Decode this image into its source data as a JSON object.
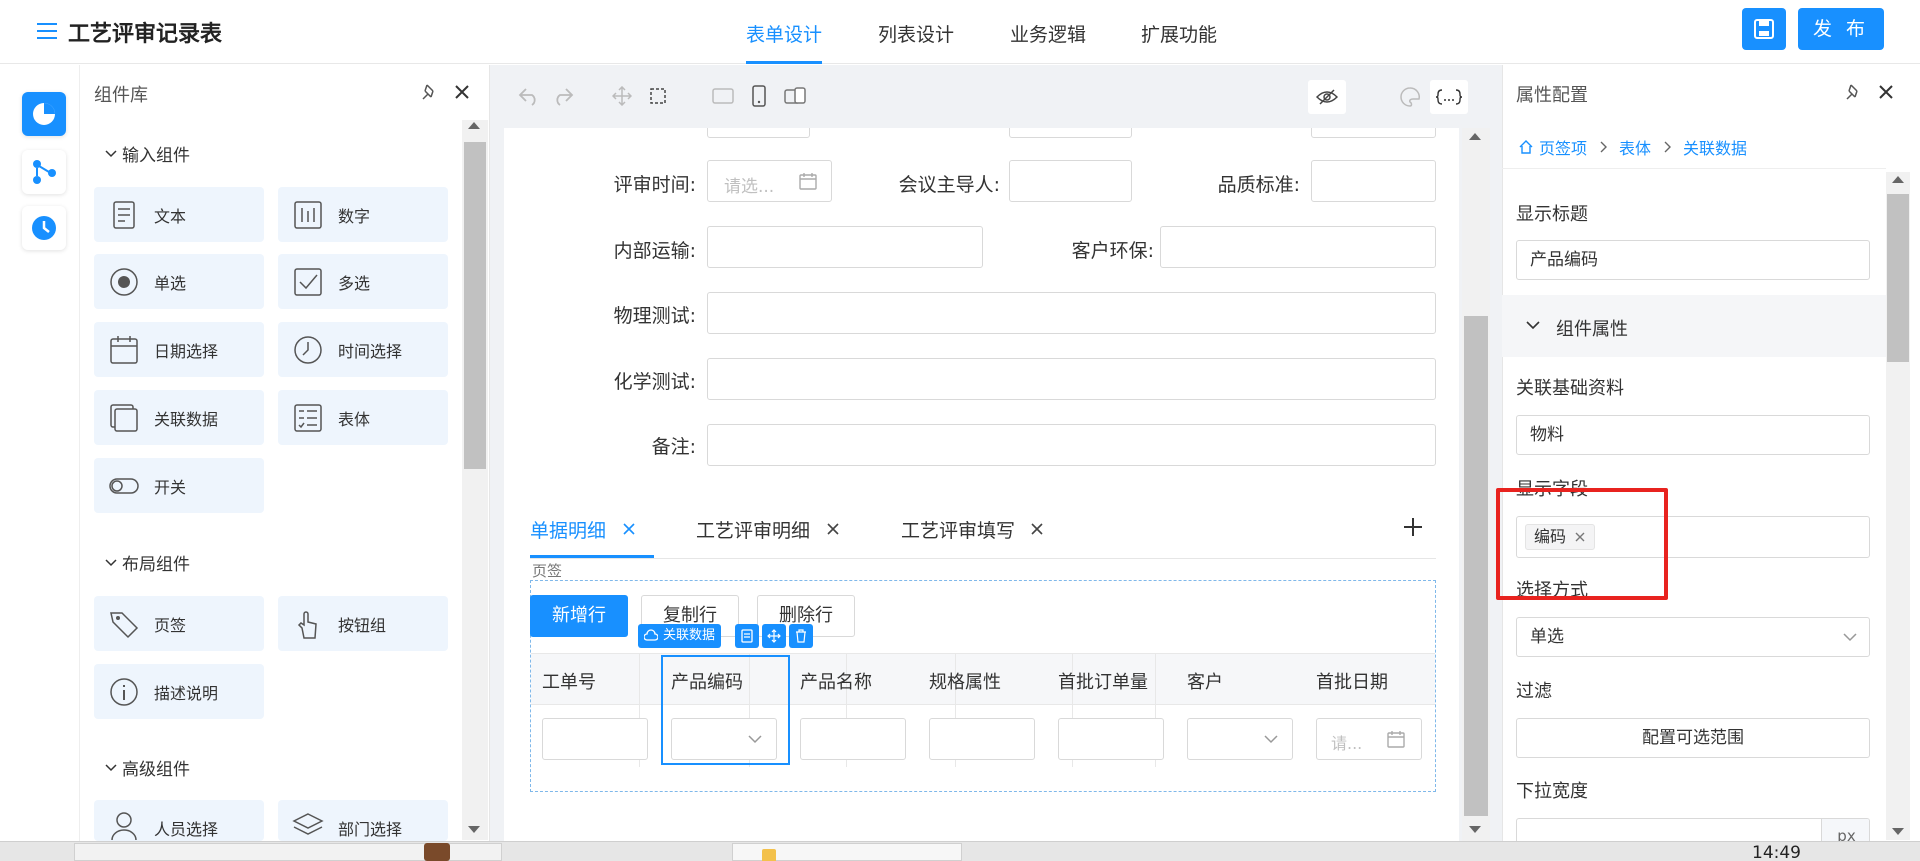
{
  "app": {
    "title": "工艺评审记录表",
    "menu_icon": "hamburger-menu-icon"
  },
  "nav": {
    "tabs": [
      {
        "label": "表单设计",
        "active": true
      },
      {
        "label": "列表设计",
        "active": false
      },
      {
        "label": "业务逻辑",
        "active": false
      },
      {
        "label": "扩展功能",
        "active": false
      }
    ],
    "save_icon": "save-icon",
    "publish_label": "发 布"
  },
  "rail": {
    "items": [
      "pie-chart-icon",
      "flow-icon",
      "clock-icon"
    ]
  },
  "library": {
    "title": "组件库",
    "groups": [
      {
        "title": "输入组件",
        "items": [
          "文本",
          "数字",
          "单选",
          "多选",
          "日期选择",
          "时间选择",
          "关联数据",
          "表体",
          "开关"
        ]
      },
      {
        "title": "布局组件",
        "items": [
          "页签",
          "按钮组",
          "描述说明"
        ]
      },
      {
        "title": "高级组件",
        "items": [
          "人员选择",
          "部门选择"
        ]
      }
    ]
  },
  "canvas": {
    "fields": {
      "review_time": {
        "label": "评审时间:",
        "placeholder": "请选..."
      },
      "meeting_lead": {
        "label": "会议主导人:"
      },
      "quality_std": {
        "label": "品质标准:"
      },
      "internal_transport": {
        "label": "内部运输:"
      },
      "customer_env": {
        "label": "客户环保:"
      },
      "physical_test": {
        "label": "物理测试:"
      },
      "chemical_test": {
        "label": "化学测试:"
      },
      "remarks": {
        "label": "备注:"
      }
    },
    "tabs": [
      "单据明细",
      "工艺评审明细",
      "工艺评审填写"
    ],
    "active_tab": "单据明细",
    "tab_hint": "页签",
    "buttons": {
      "add_row": "新增行",
      "copy_row": "复制行",
      "delete_row": "删除行"
    },
    "selected_tag": "关联数据",
    "table": {
      "columns": [
        "工单号",
        "产品编码",
        "产品名称",
        "规格属性",
        "首批订单量",
        "客户",
        "首批日期"
      ],
      "date_placeholder": "请..."
    }
  },
  "props": {
    "title": "属性配置",
    "breadcrumb": [
      "页签项",
      "表体",
      "关联数据"
    ],
    "display_title_label": "显示标题",
    "display_title_value": "产品编码",
    "section_title": "组件属性",
    "linked_base_label": "关联基础资料",
    "linked_base_value": "物料",
    "display_field_label": "显示字段",
    "display_field_tag": "编码",
    "select_mode_label": "选择方式",
    "select_mode_value": "单选",
    "filter_label": "过滤",
    "filter_button": "配置可选范围",
    "dropdown_width_label": "下拉宽度",
    "dropdown_width_unit": "px"
  },
  "colors": {
    "accent": "#1890ff",
    "highlight": "#e8231f"
  },
  "taskbar": {
    "clock": "14:49"
  }
}
